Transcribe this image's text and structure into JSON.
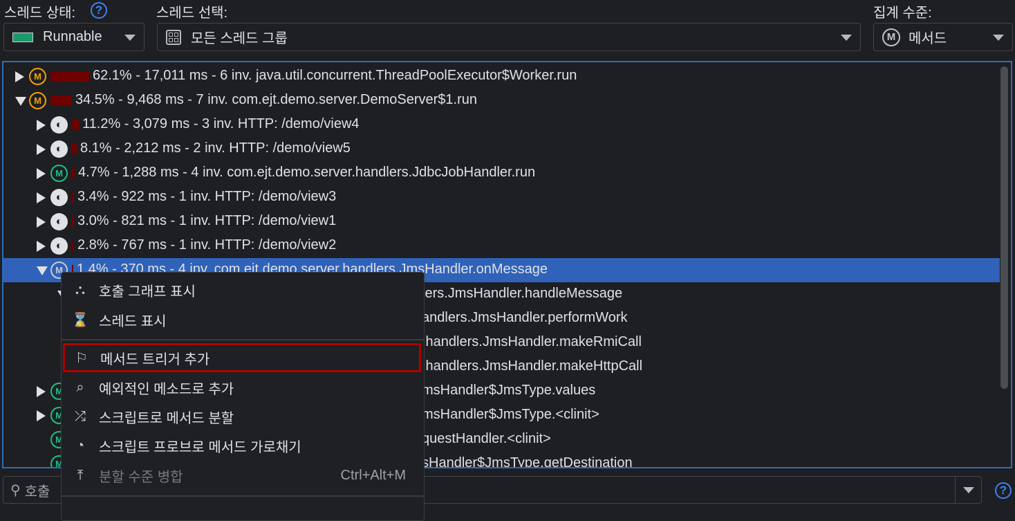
{
  "header": {
    "thread_state_label": "스레드 상태:",
    "thread_state_value": "Runnable",
    "thread_select_label": "스레드 선택:",
    "thread_select_value": "모든 스레드 그룹",
    "aggregation_label": "집계 수준:",
    "aggregation_value": "메서드",
    "help": "?"
  },
  "colors": {
    "accent": "#2f6cb5",
    "selection": "#2f62b8",
    "bar": "#6f0000",
    "runnable": "#1a9a6c",
    "highlight_box": "#b00000"
  },
  "tree": {
    "rows": [
      {
        "text": "62.1% - 17,011 ms - 6 inv. java.util.concurrent.ThreadPoolExecutor$Worker.run",
        "icon": "method-orange",
        "level": 0,
        "state": "collapsed",
        "bar": 62.1
      },
      {
        "text": "34.5% - 9,468 ms - 7 inv. com.ejt.demo.server.DemoServer$1.run",
        "icon": "method-orange",
        "level": 0,
        "state": "expanded",
        "bar": 34.5
      },
      {
        "text": "11.2% - 3,079 ms - 3 inv. HTTP: /demo/view4",
        "icon": "globe",
        "level": 1,
        "state": "collapsed",
        "bar": 11.2
      },
      {
        "text": "8.1% - 2,212 ms - 2 inv. HTTP: /demo/view5",
        "icon": "globe",
        "level": 1,
        "state": "collapsed",
        "bar": 8.1
      },
      {
        "text": "4.7% - 1,288 ms - 4 inv. com.ejt.demo.server.handlers.JdbcJobHandler.run",
        "icon": "method-green",
        "level": 1,
        "state": "collapsed",
        "bar": 4.7
      },
      {
        "text": "3.4% - 922 ms - 1 inv. HTTP: /demo/view3",
        "icon": "globe",
        "level": 1,
        "state": "collapsed",
        "bar": 3.4
      },
      {
        "text": "3.0% - 821 ms - 1 inv. HTTP: /demo/view1",
        "icon": "globe",
        "level": 1,
        "state": "collapsed",
        "bar": 3.0
      },
      {
        "text": "2.8% - 767 ms - 1 inv. HTTP: /demo/view2",
        "icon": "globe",
        "level": 1,
        "state": "collapsed",
        "bar": 2.8
      },
      {
        "text": "1.4% - 370 ms - 4 inv. com.ejt.demo.server.handlers.JmsHandler.onMessage",
        "icon": "method-white",
        "level": 1,
        "state": "expanded",
        "bar": 1.4,
        "selected": true
      },
      {
        "text": "lers.JmsHandler.handleMessage",
        "level": 2,
        "state": "expanded"
      },
      {
        "text": "andlers.JmsHandler.performWork"
      },
      {
        "text": ".handlers.JmsHandler.makeRmiCall"
      },
      {
        "text": ".handlers.JmsHandler.makeHttpCall"
      },
      {
        "text": "msHandler$JmsType.values",
        "state": "collapsed"
      },
      {
        "text": "msHandler$JmsType.<clinit>",
        "state": "collapsed"
      },
      {
        "text": "questHandler.<clinit>"
      },
      {
        "text": "sHandler$JmsType.getDestination"
      }
    ]
  },
  "context_menu": {
    "items": [
      {
        "label": "호출 그래프 표시",
        "icon": "call-graph-icon"
      },
      {
        "label": "스레드 표시",
        "icon": "thread-icon"
      },
      {
        "label": "메서드 트리거 추가",
        "icon": "flag-icon",
        "highlighted": true
      },
      {
        "label": "예외적인 메소드로 추가",
        "icon": "exceptional-method-icon"
      },
      {
        "label": "스크립트로 메서드 분할",
        "icon": "split-icon"
      },
      {
        "label": "스크립트 프로브로 메서드 가로채기",
        "icon": "probe-icon"
      },
      {
        "label": "분할 수준 병합",
        "icon": "merge-icon",
        "disabled": true,
        "shortcut": "Ctrl+Alt+M"
      }
    ]
  },
  "search": {
    "placeholder": "호출"
  }
}
